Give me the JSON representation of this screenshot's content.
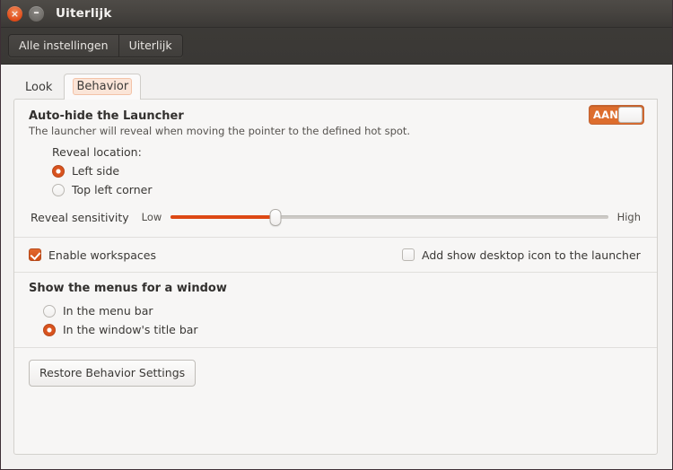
{
  "window": {
    "title": "Uiterlijk",
    "buttons": [
      {
        "name": "close",
        "glyph": "×"
      },
      {
        "name": "minimize",
        "glyph": "–"
      }
    ]
  },
  "toolbar": {
    "all_settings_label": "Alle instellingen",
    "current_panel_label": "Uiterlijk"
  },
  "tabs": [
    {
      "label": "Look",
      "active": false
    },
    {
      "label": "Behavior",
      "active": true
    }
  ],
  "autohide": {
    "title": "Auto-hide the Launcher",
    "description": "The launcher will reveal when moving the pointer to the defined hot spot.",
    "toggle": {
      "label": "AAN",
      "state": "on",
      "color": "#dd6d2d"
    },
    "reveal_location": {
      "label": "Reveal location:",
      "options": [
        {
          "label": "Left side",
          "selected": true
        },
        {
          "label": "Top left corner",
          "selected": false
        }
      ]
    },
    "reveal_sensitivity": {
      "label": "Reveal sensitivity",
      "low_label": "Low",
      "high_label": "High",
      "value_percent": 24
    }
  },
  "checkboxes": [
    {
      "label": "Enable workspaces",
      "checked": true
    },
    {
      "label": "Add show desktop icon to the launcher",
      "checked": false
    }
  ],
  "menus": {
    "title": "Show the menus for a window",
    "options": [
      {
        "label": "In the menu bar",
        "selected": false
      },
      {
        "label": "In the window's title bar",
        "selected": true
      }
    ]
  },
  "restore": {
    "label": "Restore Behavior Settings"
  },
  "colors": {
    "accent": "#dd4814",
    "titlebar": "#474440",
    "panel_bg": "#f7f6f5"
  }
}
